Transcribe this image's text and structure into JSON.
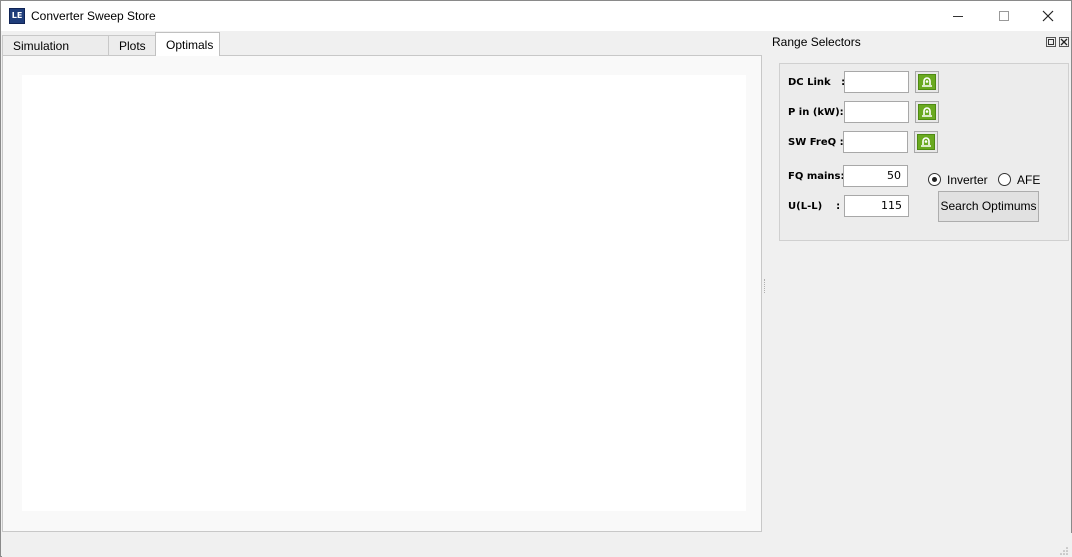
{
  "window": {
    "title": "Converter Sweep Store",
    "icon": "le-app-icon",
    "icon_text": "LE"
  },
  "tabs": [
    {
      "label": "Simulation Inputs",
      "active": false
    },
    {
      "label": "Plots",
      "active": false
    },
    {
      "label": "Optimals",
      "active": true
    }
  ],
  "dock": {
    "title": "Range Selectors",
    "fields": {
      "dc_link": {
        "label": "DC Link   :",
        "value": ""
      },
      "p_in": {
        "label": "P in (kW):",
        "value": ""
      },
      "sw_freq": {
        "label": "SW FreQ :",
        "value": ""
      },
      "fq_mains": {
        "label": "FQ mains:",
        "value": "50"
      },
      "u_ll": {
        "label": "U(L-L)    :",
        "value": "115"
      }
    },
    "mode": {
      "inverter_label": "Inverter",
      "afe_label": "AFE",
      "selected": "Inverter"
    },
    "search_button": "Search Optimums"
  },
  "colors": {
    "accent_green": "#6aaa20",
    "panel_bg": "#f0f0f0"
  }
}
